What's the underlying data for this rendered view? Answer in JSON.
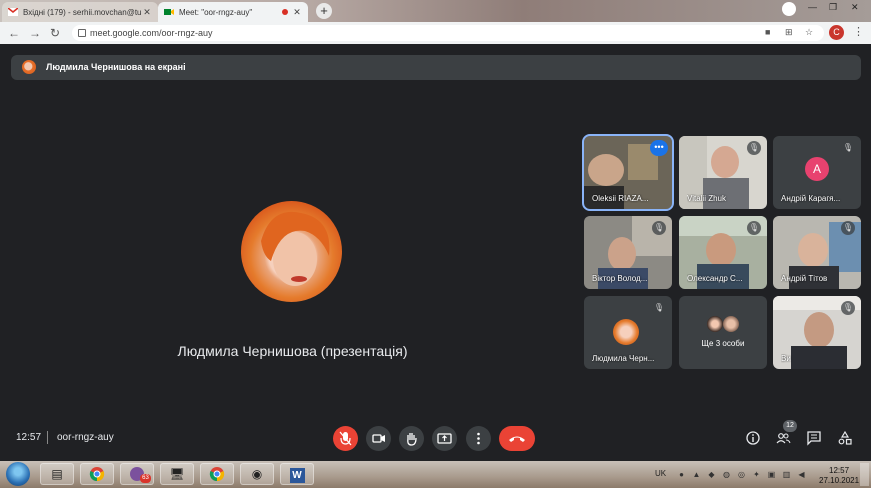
{
  "browser": {
    "tabs": [
      {
        "title": "Вхідні (179) - serhii.movchan@tu",
        "active": false
      },
      {
        "title": "Meet: \"oor-rngz-auy\"",
        "active": true
      }
    ],
    "new_tab": "+",
    "window_controls": {
      "minimize": "—",
      "maximize": "❐",
      "close": "✕"
    },
    "nav": {
      "back": "←",
      "forward": "→",
      "reload": "↻"
    },
    "url": "meet.google.com/oor-rngz-auy",
    "profile_letter": "C"
  },
  "meet": {
    "presenting_banner": "Людмила Чернишова на екрані",
    "main_tile_name": "Людмила Чернишова (презентація)",
    "tiles": [
      {
        "name": "Oleksii RIAZA...",
        "selected": true,
        "muted": false
      },
      {
        "name": "Vitalii Zhuk",
        "muted": true
      },
      {
        "name": "Андрій Карагя...",
        "muted": true,
        "avatar_letter": "A"
      },
      {
        "name": "Віктор Волод...",
        "muted": true
      },
      {
        "name": "Олександр С...",
        "muted": true
      },
      {
        "name": "Андрій Тітов",
        "muted": true
      },
      {
        "name": "Людмила Черн...",
        "muted": true
      },
      {
        "name": "Ще 3 особи",
        "muted": false
      },
      {
        "name": "Ви",
        "muted": true
      }
    ],
    "bottom": {
      "time": "12:57",
      "meeting_code": "oor-rngz-auy",
      "participants_count": "12"
    }
  },
  "taskbar": {
    "viber_badge": "63",
    "language": "UK",
    "clock_time": "12:57",
    "clock_date": "27.10.2021"
  },
  "colors": {
    "meet_bg": "#202124",
    "tile_bg": "#3c4043",
    "danger_red": "#ea4335",
    "selected_outline": "#8ab4f8"
  }
}
